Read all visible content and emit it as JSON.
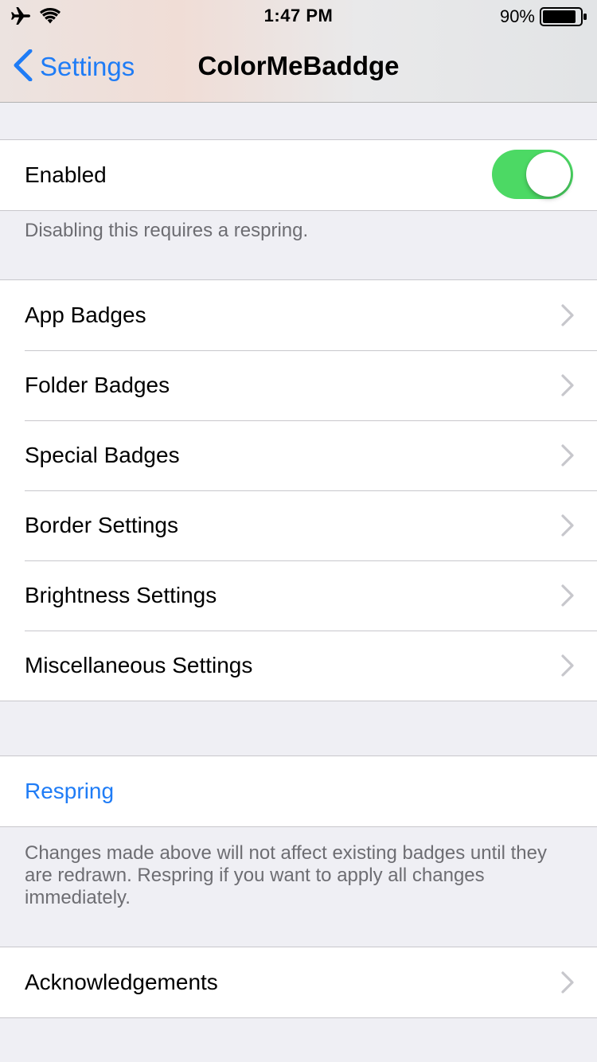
{
  "status_bar": {
    "time": "1:47 PM",
    "battery_percent": "90%",
    "battery_level": 0.9,
    "icons": [
      "airplane-icon",
      "wifi-icon",
      "battery-icon"
    ]
  },
  "nav": {
    "back_label": "Settings",
    "title": "ColorMeBaddge"
  },
  "enabled_section": {
    "label": "Enabled",
    "toggle_on": true,
    "footer": "Disabling this requires a respring."
  },
  "menu_items": [
    {
      "label": "App Badges"
    },
    {
      "label": "Folder Badges"
    },
    {
      "label": "Special Badges"
    },
    {
      "label": "Border Settings"
    },
    {
      "label": "Brightness Settings"
    },
    {
      "label": "Miscellaneous Settings"
    }
  ],
  "respring_section": {
    "label": "Respring",
    "footer": "Changes made above will not affect existing badges until they are redrawn.  Respring if you want to apply all changes immediately."
  },
  "ack_section": {
    "label": "Acknowledgements"
  },
  "colors": {
    "accent": "#1f7cf6",
    "toggle_on": "#4cd964",
    "background": "#efeff4",
    "separator": "#c8c7cc",
    "footer_text": "#6d6d72"
  }
}
